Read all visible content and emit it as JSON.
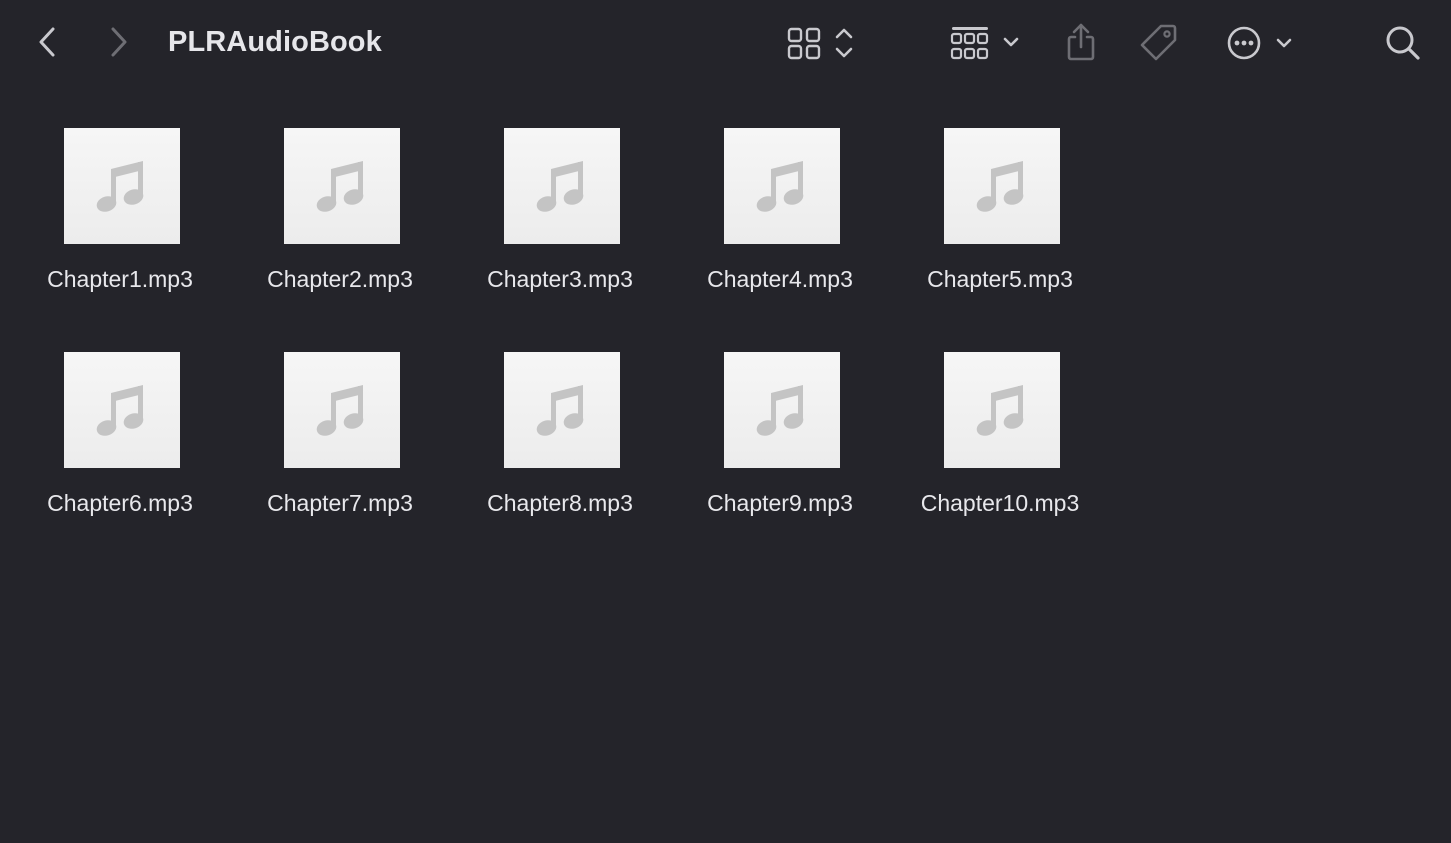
{
  "window": {
    "title": "PLRAudioBook"
  },
  "toolbar": {
    "back_icon": "chevron-left-icon",
    "forward_icon": "chevron-right-icon",
    "view_icon": "icon-grid-view-icon",
    "group_icon": "group-by-icon",
    "share_icon": "share-icon",
    "tag_icon": "tag-icon",
    "more_icon": "ellipsis-circle-icon",
    "search_icon": "search-icon"
  },
  "colors": {
    "background": "#24242a",
    "text": "#e8e8ec",
    "icon": "#c9c9ce",
    "icon_disabled": "#6e6e74",
    "thumbnail": "#f2f2f2",
    "note": "#c4c4c4"
  },
  "files": [
    {
      "name": "Chapter1.mp3",
      "icon": "music-note-icon"
    },
    {
      "name": "Chapter2.mp3",
      "icon": "music-note-icon"
    },
    {
      "name": "Chapter3.mp3",
      "icon": "music-note-icon"
    },
    {
      "name": "Chapter4.mp3",
      "icon": "music-note-icon"
    },
    {
      "name": "Chapter5.mp3",
      "icon": "music-note-icon"
    },
    {
      "name": "Chapter6.mp3",
      "icon": "music-note-icon"
    },
    {
      "name": "Chapter7.mp3",
      "icon": "music-note-icon"
    },
    {
      "name": "Chapter8.mp3",
      "icon": "music-note-icon"
    },
    {
      "name": "Chapter9.mp3",
      "icon": "music-note-icon"
    },
    {
      "name": "Chapter10.mp3",
      "icon": "music-note-icon"
    }
  ]
}
